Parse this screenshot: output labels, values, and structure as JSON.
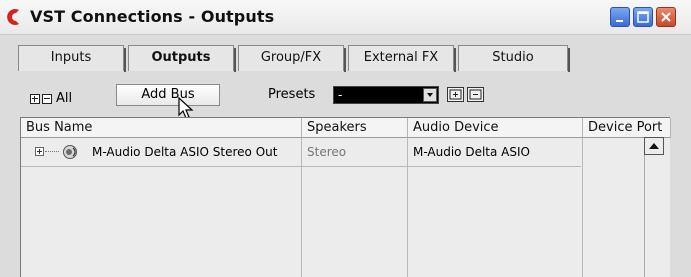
{
  "window": {
    "title": "VST Connections - Outputs"
  },
  "tabs": [
    {
      "label": "Inputs",
      "active": false
    },
    {
      "label": "Outputs",
      "active": true
    },
    {
      "label": "Group/FX",
      "active": false
    },
    {
      "label": "External FX",
      "active": false
    },
    {
      "label": "Studio",
      "active": false
    }
  ],
  "toolbar": {
    "all_label": "All",
    "add_bus_label": "Add Bus",
    "presets_label": "Presets",
    "presets_value": "-"
  },
  "table": {
    "columns": [
      "Bus Name",
      "Speakers",
      "Audio Device",
      "Device Port"
    ],
    "rows": [
      {
        "bus_name": "M-Audio Delta ASIO Stereo Out",
        "speakers": "Stereo",
        "audio_device": "M-Audio Delta ASIO",
        "device_port": ""
      }
    ]
  },
  "colors": {
    "title_bar": "#efefef",
    "panel_bg": "#dcdcdc",
    "close_button": "#d45a3a",
    "window_buttons": "#4f7fe0",
    "presets_field": "#000000"
  },
  "icons": [
    "cubase-logo-icon",
    "minimize-icon",
    "maximize-icon",
    "close-icon",
    "expand-all-icon",
    "collapse-all-icon",
    "mouse-pointer-icon",
    "dropdown-arrow-icon",
    "store-preset-icon",
    "remove-preset-icon",
    "tree-expand-icon",
    "speaker-bus-icon",
    "scroll-up-icon"
  ]
}
